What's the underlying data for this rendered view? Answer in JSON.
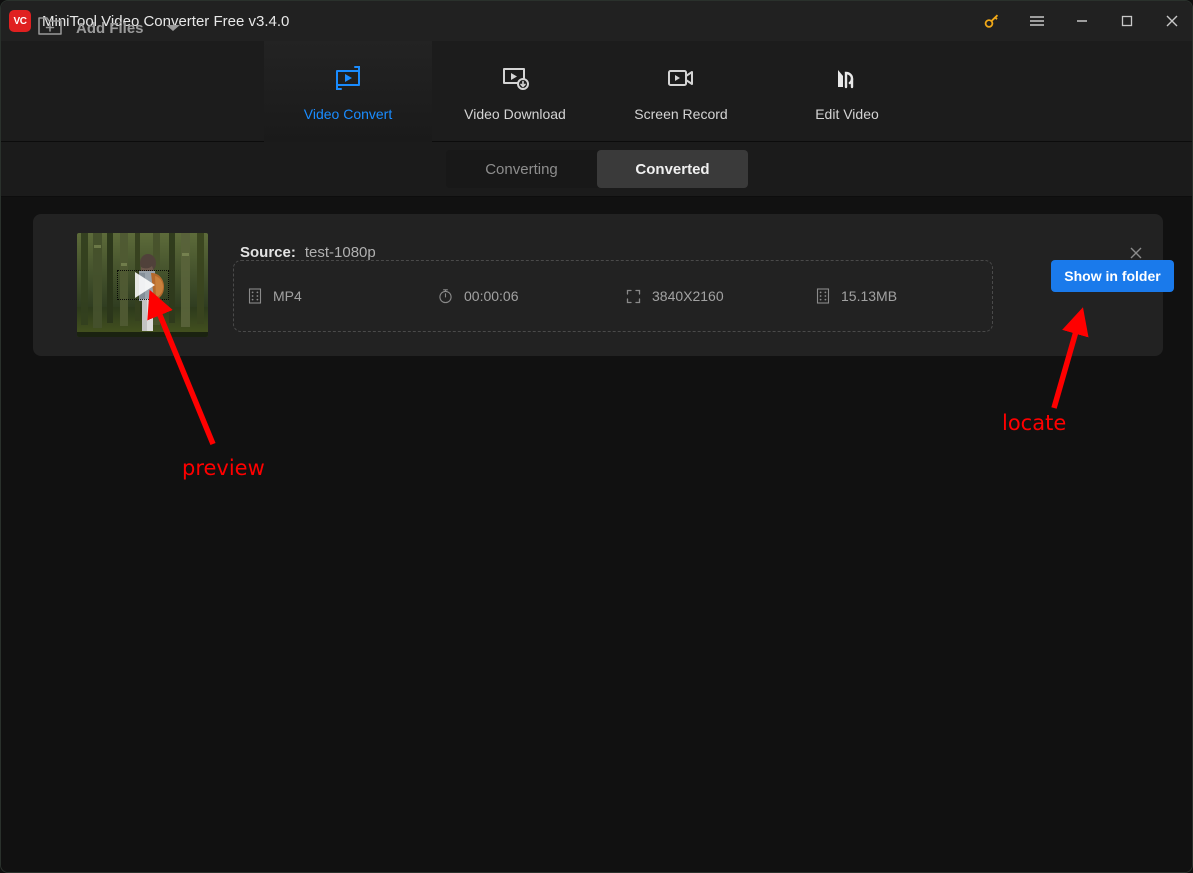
{
  "window": {
    "title": "MiniTool Video Converter Free v3.4.0",
    "logo_text": "VC",
    "controls": [
      {
        "name": "key-icon",
        "label": "Activate"
      },
      {
        "name": "menu-icon",
        "label": "Menu"
      },
      {
        "name": "minimize-icon",
        "label": "Minimize"
      },
      {
        "name": "maximize-icon",
        "label": "Maximize"
      },
      {
        "name": "close-icon",
        "label": "Close"
      }
    ],
    "accent_blue": "#1a8cff",
    "button_blue": "#1a7aeb",
    "logo_red": "#e02020",
    "annotation_red": "#ff0000"
  },
  "tabs": [
    {
      "label": "Video Convert",
      "icon": "convert-loop-icon",
      "active": true
    },
    {
      "label": "Video Download",
      "icon": "video-download-icon",
      "active": false
    },
    {
      "label": "Screen Record",
      "icon": "camcorder-icon",
      "active": false
    },
    {
      "label": "Edit Video",
      "icon": "edit-video-icon",
      "active": false
    }
  ],
  "toolbar": {
    "add_files_label": "Add Files",
    "add_files_icon": "folder-plus-icon",
    "dropdown_icon": "caret-down-icon",
    "segments": [
      {
        "label": "Converting",
        "active": false
      },
      {
        "label": "Converted",
        "active": true
      }
    ]
  },
  "file_card": {
    "source_label": "Source:",
    "source_value": "test-1080p",
    "close_icon": "close-icon",
    "play_icon": "play-icon",
    "info": [
      {
        "icon": "film-format-icon",
        "value": "MP4"
      },
      {
        "icon": "timer-icon",
        "value": "00:00:06"
      },
      {
        "icon": "resolution-icon",
        "value": "3840X2160"
      },
      {
        "icon": "file-size-icon",
        "value": "15.13MB"
      }
    ],
    "action_button": "Show in folder"
  },
  "annotations": [
    {
      "text": "preview",
      "points_to": "play-icon"
    },
    {
      "text": "locate",
      "points_to": "show-in-folder-button"
    }
  ]
}
